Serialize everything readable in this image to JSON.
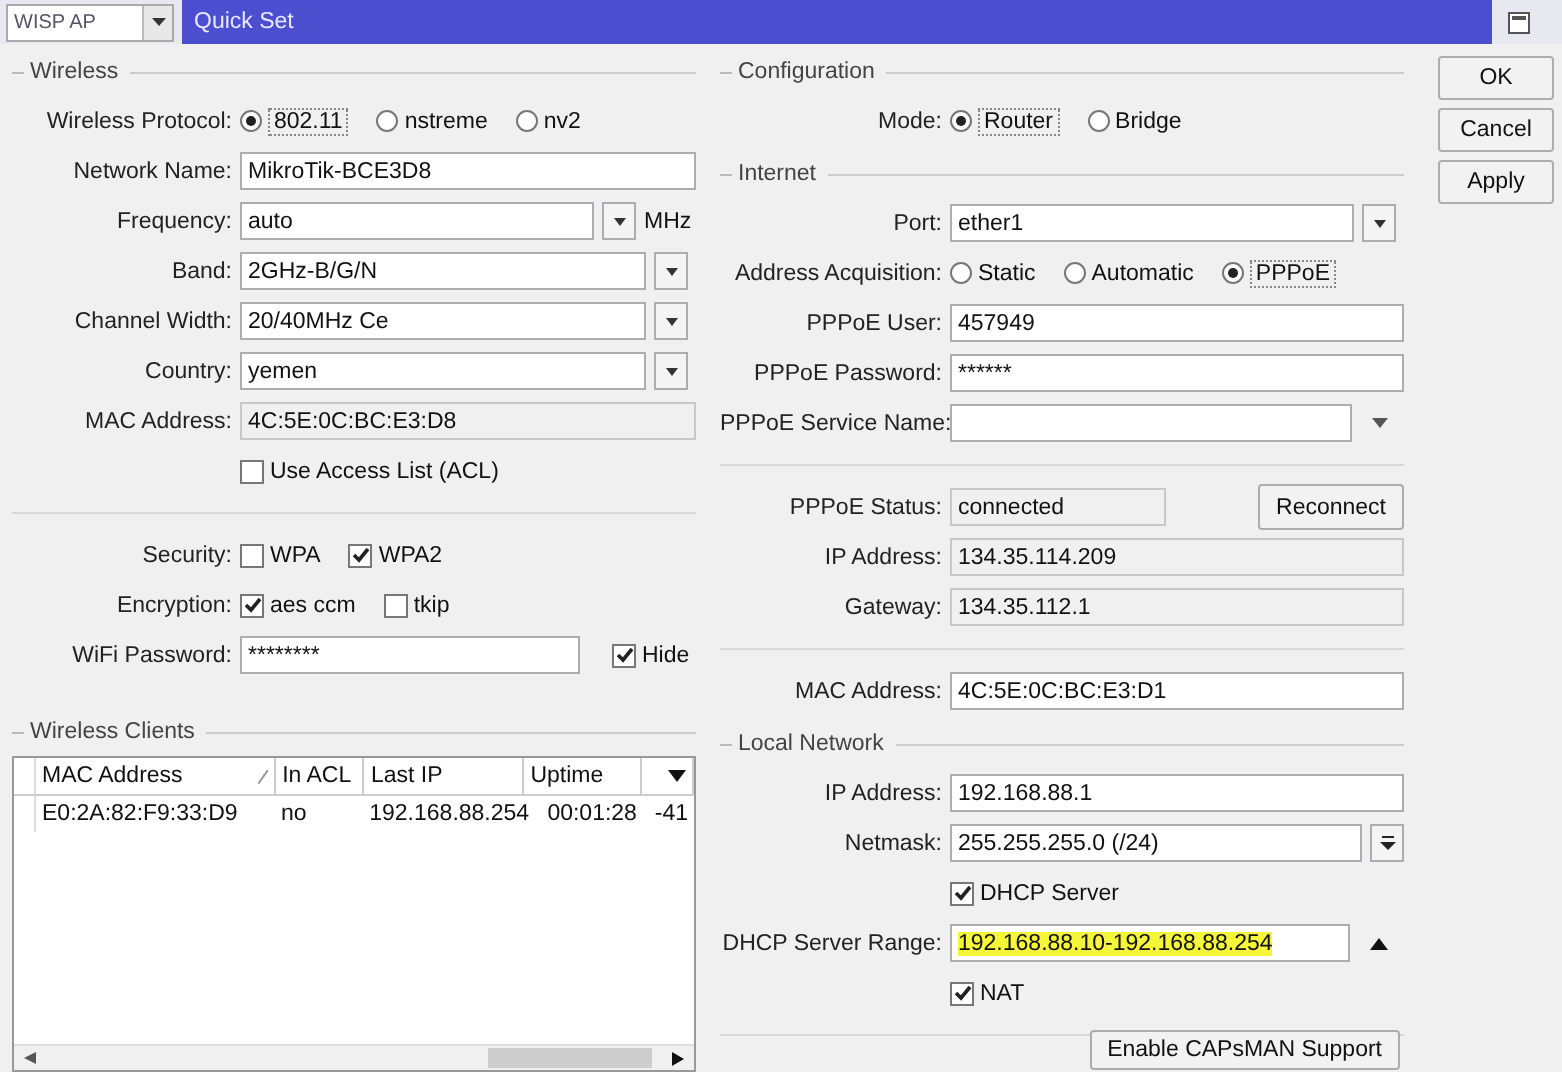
{
  "window": {
    "mode_select": "WISP AP",
    "title": "Quick Set"
  },
  "buttons": [
    "OK",
    "Cancel",
    "Apply"
  ],
  "left": {
    "sections": [
      {
        "title": "Wireless",
        "rows": [
          {
            "kind": "radio",
            "label": "Wireless Protocol:",
            "options": [
              {
                "label": "802.11",
                "selected": true
              },
              {
                "label": "nstreme",
                "selected": false
              },
              {
                "label": "nv2",
                "selected": false
              }
            ]
          },
          {
            "kind": "text",
            "label": "Network Name:",
            "value": "MikroTik-BCE3D8"
          },
          {
            "kind": "select",
            "label": "Frequency:",
            "value": "auto",
            "suffix": "MHz"
          },
          {
            "kind": "select",
            "label": "Band:",
            "value": "2GHz-B/G/N"
          },
          {
            "kind": "select",
            "label": "Channel Width:",
            "value": "20/40MHz Ce"
          },
          {
            "kind": "select",
            "label": "Country:",
            "value": "yemen"
          },
          {
            "kind": "readonly",
            "label": "MAC Address:",
            "value": "4C:5E:0C:BC:E3:D8"
          },
          {
            "kind": "checks",
            "options": [
              {
                "label": "Use Access List (ACL)",
                "checked": false
              }
            ]
          },
          {
            "kind": "divider"
          },
          {
            "kind": "checks",
            "label": "Security:",
            "options": [
              {
                "label": "WPA",
                "checked": false
              },
              {
                "label": "WPA2",
                "checked": true
              }
            ]
          },
          {
            "kind": "checks",
            "label": "Encryption:",
            "options": [
              {
                "label": "aes ccm",
                "checked": true
              },
              {
                "label": "tkip",
                "checked": false
              }
            ]
          },
          {
            "kind": "password",
            "label": "WiFi Password:",
            "value": "********",
            "hide": {
              "label": "Hide",
              "checked": true
            }
          }
        ]
      }
    ],
    "clients": {
      "title": "Wireless Clients",
      "columns": [
        "MAC Address",
        "In ACL",
        "Last IP",
        "Uptime"
      ],
      "rows": [
        {
          "mac_address": "E0:2A:82:F9:33:D9",
          "in_acl": "no",
          "last_ip": "192.168.88.254",
          "uptime": "00:01:28",
          "column_5": "-41"
        }
      ]
    }
  },
  "right": {
    "sections": [
      {
        "title": "Configuration",
        "rows": [
          {
            "kind": "radio",
            "label": "Mode:",
            "options": [
              {
                "label": "Router",
                "selected": true
              },
              {
                "label": "Bridge",
                "selected": false
              }
            ]
          }
        ]
      },
      {
        "title": "Internet",
        "rows": [
          {
            "kind": "select",
            "label": "Port:",
            "value": "ether1"
          },
          {
            "kind": "radio",
            "label": "Address Acquisition:",
            "options": [
              {
                "label": "Static",
                "selected": false
              },
              {
                "label": "Automatic",
                "selected": false
              },
              {
                "label": "PPPoE",
                "selected": true
              }
            ]
          },
          {
            "kind": "text",
            "label": "PPPoE User:",
            "value": "457949"
          },
          {
            "kind": "text",
            "label": "PPPoE Password:",
            "value": "******"
          },
          {
            "kind": "combo",
            "label": "PPPoE Service Name:"
          },
          {
            "kind": "divider"
          },
          {
            "kind": "status",
            "label": "PPPoE Status:",
            "value": "connected",
            "button": "Reconnect"
          },
          {
            "kind": "readonly",
            "label": "IP Address:",
            "value": "134.35.114.209"
          },
          {
            "kind": "readonly",
            "label": "Gateway:",
            "value": "134.35.112.1"
          }
        ]
      },
      {
        "rows": [
          {
            "kind": "divider"
          },
          {
            "kind": "text",
            "label": "MAC Address:",
            "value": "4C:5E:0C:BC:E3:D1"
          }
        ]
      },
      {
        "title": "Local Network",
        "rows": [
          {
            "kind": "text",
            "label": "IP Address:",
            "value": "192.168.88.1"
          },
          {
            "kind": "netmask",
            "label": "Netmask:",
            "value": "255.255.255.0 (/24)"
          },
          {
            "kind": "checks",
            "options": [
              {
                "label": "DHCP Server",
                "checked": true
              }
            ]
          },
          {
            "kind": "range",
            "label": "DHCP Server Range:",
            "value": "192.168.88.10-192.168.88.254"
          },
          {
            "kind": "checks",
            "options": [
              {
                "label": "NAT",
                "checked": true
              }
            ]
          },
          {
            "kind": "divider"
          }
        ]
      }
    ],
    "capsman_button": "Enable CAPsMAN Support"
  }
}
